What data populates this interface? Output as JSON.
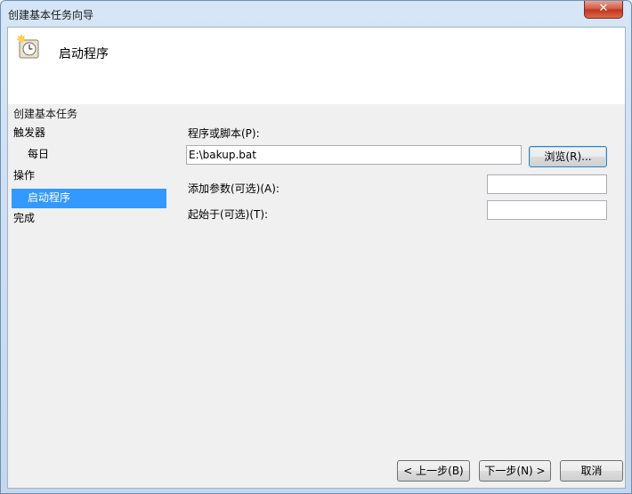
{
  "window": {
    "title": "创建基本任务向导",
    "close_label": "✕"
  },
  "header": {
    "icon": "clock-icon",
    "title": "启动程序"
  },
  "section_title": "创建基本任务",
  "nav": {
    "items": [
      {
        "label": "触发器",
        "indent": false,
        "selected": false
      },
      {
        "label": "每日",
        "indent": true,
        "selected": false
      },
      {
        "label": "操作",
        "indent": false,
        "selected": false
      },
      {
        "label": "启动程序",
        "indent": true,
        "selected": true
      },
      {
        "label": "完成",
        "indent": false,
        "selected": false
      }
    ]
  },
  "form": {
    "program_label": "程序或脚本(P):",
    "program_value": "E:\\bakup.bat",
    "browse_label": "浏览(R)...",
    "args_label": "添加参数(可选)(A):",
    "args_value": "",
    "startin_label": "起始于(可选)(T):",
    "startin_value": ""
  },
  "footer": {
    "back_label": "< 上一步(B)",
    "next_label": "下一步(N) >",
    "cancel_label": "取消"
  },
  "colors": {
    "selection": "#3399ff",
    "close_button": "#c1321a"
  }
}
